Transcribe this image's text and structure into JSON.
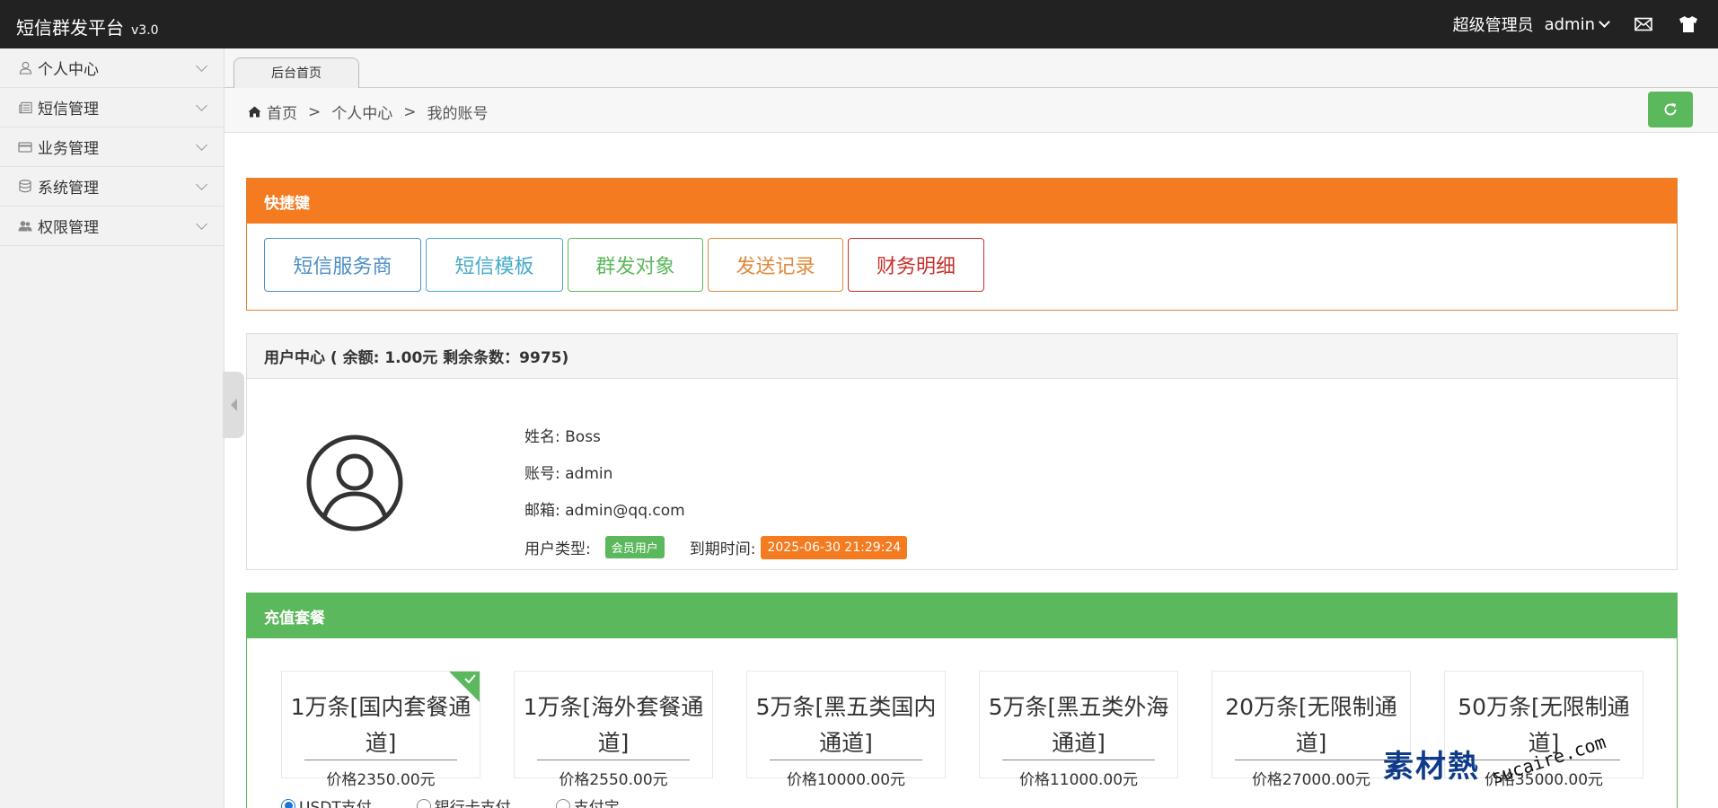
{
  "app": {
    "title": "短信群发平台",
    "version": "v3.0"
  },
  "topbar": {
    "role": "超级管理员",
    "username": "admin"
  },
  "sidebar": {
    "items": [
      {
        "label": "个人中心",
        "icon": "user-icon"
      },
      {
        "label": "短信管理",
        "icon": "newspaper-icon"
      },
      {
        "label": "业务管理",
        "icon": "credit-card-icon"
      },
      {
        "label": "系统管理",
        "icon": "database-icon"
      },
      {
        "label": "权限管理",
        "icon": "users-icon"
      }
    ]
  },
  "tabs": [
    {
      "label": "后台首页"
    }
  ],
  "breadcrumb": {
    "items": [
      "首页",
      "个人中心",
      "我的账号"
    ],
    "separator": ">"
  },
  "quick": {
    "title": "快捷键",
    "buttons": [
      "短信服务商",
      "短信模板",
      "群发对象",
      "发送记录",
      "财务明细"
    ]
  },
  "user_center": {
    "title": "用户中心 ( 余额: 1.00元 剩余条数：9975)",
    "name": "姓名: Boss",
    "account": "账号: admin",
    "email": "邮箱:  admin@qq.com",
    "type_label": "用户类型:",
    "type_value": "会员用户",
    "expire_label": "到期时间:",
    "expire_value": "2025-06-30 21:29:24"
  },
  "recharge": {
    "title": "充值套餐",
    "packages": [
      {
        "name": "1万条[国内套餐通道]",
        "price": "价格2350.00元",
        "selected": true
      },
      {
        "name": "1万条[海外套餐通道]",
        "price": "价格2550.00元",
        "selected": false
      },
      {
        "name": "5万条[黑五类国内通道]",
        "price": "价格10000.00元",
        "selected": false
      },
      {
        "name": "5万条[黑五类外海通道]",
        "price": "价格11000.00元",
        "selected": false
      },
      {
        "name": "20万条[无限制通道]",
        "price": "价格27000.00元",
        "selected": false
      },
      {
        "name": "50万条[无限制通道]",
        "price": "价格35000.00元",
        "selected": false
      }
    ],
    "payments": [
      "USDT支付",
      "银行卡支付",
      "支付宝"
    ]
  },
  "watermark": {
    "cn": "素材熱",
    "en": "sucaire.com"
  },
  "colors": {
    "orange": "#f47b20",
    "green": "#5cb85c",
    "topbar": "#222222"
  }
}
